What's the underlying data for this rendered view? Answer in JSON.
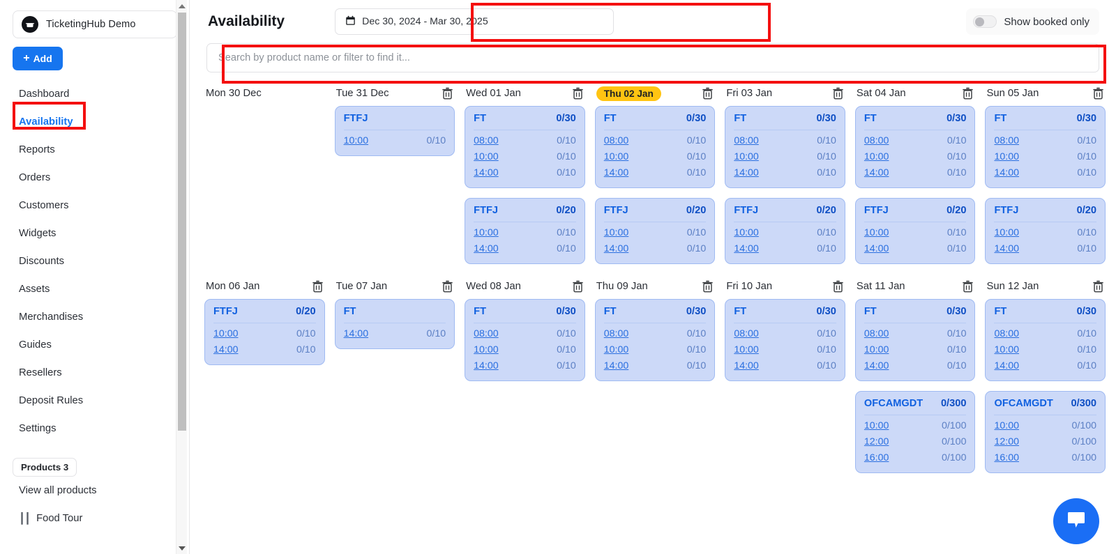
{
  "sidebar": {
    "brand": {
      "name": "TicketingHub Demo",
      "logo_icon": "ticket-circle-icon"
    },
    "add_button": {
      "label": "Add",
      "plus": "+"
    },
    "items": [
      {
        "label": "Dashboard",
        "active": false
      },
      {
        "label": "Availability",
        "active": true
      },
      {
        "label": "Reports",
        "active": false
      },
      {
        "label": "Orders",
        "active": false
      },
      {
        "label": "Customers",
        "active": false
      },
      {
        "label": "Widgets",
        "active": false
      },
      {
        "label": "Discounts",
        "active": false
      },
      {
        "label": "Assets",
        "active": false
      },
      {
        "label": "Merchandises",
        "active": false
      },
      {
        "label": "Guides",
        "active": false
      },
      {
        "label": "Resellers",
        "active": false
      },
      {
        "label": "Deposit Rules",
        "active": false
      },
      {
        "label": "Settings",
        "active": false
      }
    ],
    "products_tag": "Products 3",
    "view_all_products": "View all products",
    "product_items": [
      {
        "label": "Food Tour",
        "handle_icon": "drag-handle-icon"
      }
    ]
  },
  "header": {
    "title": "Availability",
    "date_range": {
      "value": "Dec 30, 2024 - Mar 30, 2025",
      "icon": "calendar-icon"
    },
    "show_booked_only": {
      "label": "Show booked only",
      "enabled": false
    }
  },
  "search": {
    "placeholder": "Search by product name or filter to find it...",
    "value": ""
  },
  "colors": {
    "accent": "#1675ef",
    "card_bg": "#ccd9f8",
    "card_border": "#9fbaf2",
    "today_badge": "#ffc412",
    "annotation": "#f40f0f",
    "chat_fab": "#1a6ef5"
  },
  "calendar": {
    "delete_icon": "trash-icon",
    "weeks": [
      {
        "days": [
          {
            "label": "Mon 30 Dec",
            "today": false,
            "deletable": false,
            "cards": []
          },
          {
            "label": "Tue 31 Dec",
            "today": false,
            "deletable": true,
            "cards": [
              {
                "product": "FTFJ",
                "capacity": "",
                "slots": [
                  {
                    "time": "10:00",
                    "capacity": "0/10"
                  }
                ]
              }
            ]
          },
          {
            "label": "Wed 01 Jan",
            "today": false,
            "deletable": true,
            "cards": [
              {
                "product": "FT",
                "capacity": "0/30",
                "slots": [
                  {
                    "time": "08:00",
                    "capacity": "0/10"
                  },
                  {
                    "time": "10:00",
                    "capacity": "0/10"
                  },
                  {
                    "time": "14:00",
                    "capacity": "0/10"
                  }
                ]
              },
              {
                "product": "FTFJ",
                "capacity": "0/20",
                "slots": [
                  {
                    "time": "10:00",
                    "capacity": "0/10"
                  },
                  {
                    "time": "14:00",
                    "capacity": "0/10"
                  }
                ]
              }
            ]
          },
          {
            "label": "Thu 02 Jan",
            "today": true,
            "deletable": true,
            "cards": [
              {
                "product": "FT",
                "capacity": "0/30",
                "slots": [
                  {
                    "time": "08:00",
                    "capacity": "0/10"
                  },
                  {
                    "time": "10:00",
                    "capacity": "0/10"
                  },
                  {
                    "time": "14:00",
                    "capacity": "0/10"
                  }
                ]
              },
              {
                "product": "FTFJ",
                "capacity": "0/20",
                "slots": [
                  {
                    "time": "10:00",
                    "capacity": "0/10"
                  },
                  {
                    "time": "14:00",
                    "capacity": "0/10"
                  }
                ]
              }
            ]
          },
          {
            "label": "Fri 03 Jan",
            "today": false,
            "deletable": true,
            "cards": [
              {
                "product": "FT",
                "capacity": "0/30",
                "slots": [
                  {
                    "time": "08:00",
                    "capacity": "0/10"
                  },
                  {
                    "time": "10:00",
                    "capacity": "0/10"
                  },
                  {
                    "time": "14:00",
                    "capacity": "0/10"
                  }
                ]
              },
              {
                "product": "FTFJ",
                "capacity": "0/20",
                "slots": [
                  {
                    "time": "10:00",
                    "capacity": "0/10"
                  },
                  {
                    "time": "14:00",
                    "capacity": "0/10"
                  }
                ]
              }
            ]
          },
          {
            "label": "Sat 04 Jan",
            "today": false,
            "deletable": true,
            "cards": [
              {
                "product": "FT",
                "capacity": "0/30",
                "slots": [
                  {
                    "time": "08:00",
                    "capacity": "0/10"
                  },
                  {
                    "time": "10:00",
                    "capacity": "0/10"
                  },
                  {
                    "time": "14:00",
                    "capacity": "0/10"
                  }
                ]
              },
              {
                "product": "FTFJ",
                "capacity": "0/20",
                "slots": [
                  {
                    "time": "10:00",
                    "capacity": "0/10"
                  },
                  {
                    "time": "14:00",
                    "capacity": "0/10"
                  }
                ]
              }
            ]
          },
          {
            "label": "Sun 05 Jan",
            "today": false,
            "deletable": true,
            "cards": [
              {
                "product": "FT",
                "capacity": "0/30",
                "slots": [
                  {
                    "time": "08:00",
                    "capacity": "0/10"
                  },
                  {
                    "time": "10:00",
                    "capacity": "0/10"
                  },
                  {
                    "time": "14:00",
                    "capacity": "0/10"
                  }
                ]
              },
              {
                "product": "FTFJ",
                "capacity": "0/20",
                "slots": [
                  {
                    "time": "10:00",
                    "capacity": "0/10"
                  },
                  {
                    "time": "14:00",
                    "capacity": "0/10"
                  }
                ]
              }
            ]
          }
        ]
      },
      {
        "days": [
          {
            "label": "Mon 06 Jan",
            "today": false,
            "deletable": true,
            "cards": [
              {
                "product": "FTFJ",
                "capacity": "0/20",
                "slots": [
                  {
                    "time": "10:00",
                    "capacity": "0/10"
                  },
                  {
                    "time": "14:00",
                    "capacity": "0/10"
                  }
                ]
              }
            ]
          },
          {
            "label": "Tue 07 Jan",
            "today": false,
            "deletable": true,
            "cards": [
              {
                "product": "FT",
                "capacity": "",
                "slots": [
                  {
                    "time": "14:00",
                    "capacity": "0/10"
                  }
                ]
              }
            ]
          },
          {
            "label": "Wed 08 Jan",
            "today": false,
            "deletable": true,
            "cards": [
              {
                "product": "FT",
                "capacity": "0/30",
                "slots": [
                  {
                    "time": "08:00",
                    "capacity": "0/10"
                  },
                  {
                    "time": "10:00",
                    "capacity": "0/10"
                  },
                  {
                    "time": "14:00",
                    "capacity": "0/10"
                  }
                ]
              }
            ]
          },
          {
            "label": "Thu 09 Jan",
            "today": false,
            "deletable": true,
            "cards": [
              {
                "product": "FT",
                "capacity": "0/30",
                "slots": [
                  {
                    "time": "08:00",
                    "capacity": "0/10"
                  },
                  {
                    "time": "10:00",
                    "capacity": "0/10"
                  },
                  {
                    "time": "14:00",
                    "capacity": "0/10"
                  }
                ]
              }
            ]
          },
          {
            "label": "Fri 10 Jan",
            "today": false,
            "deletable": true,
            "cards": [
              {
                "product": "FT",
                "capacity": "0/30",
                "slots": [
                  {
                    "time": "08:00",
                    "capacity": "0/10"
                  },
                  {
                    "time": "10:00",
                    "capacity": "0/10"
                  },
                  {
                    "time": "14:00",
                    "capacity": "0/10"
                  }
                ]
              }
            ]
          },
          {
            "label": "Sat 11 Jan",
            "today": false,
            "deletable": true,
            "cards": [
              {
                "product": "FT",
                "capacity": "0/30",
                "slots": [
                  {
                    "time": "08:00",
                    "capacity": "0/10"
                  },
                  {
                    "time": "10:00",
                    "capacity": "0/10"
                  },
                  {
                    "time": "14:00",
                    "capacity": "0/10"
                  }
                ]
              },
              {
                "product": "OFCAMGDT",
                "capacity": "0/300",
                "slots": [
                  {
                    "time": "10:00",
                    "capacity": "0/100"
                  },
                  {
                    "time": "12:00",
                    "capacity": "0/100"
                  },
                  {
                    "time": "16:00",
                    "capacity": "0/100"
                  }
                ]
              }
            ]
          },
          {
            "label": "Sun 12 Jan",
            "today": false,
            "deletable": true,
            "cards": [
              {
                "product": "FT",
                "capacity": "0/30",
                "slots": [
                  {
                    "time": "08:00",
                    "capacity": "0/10"
                  },
                  {
                    "time": "10:00",
                    "capacity": "0/10"
                  },
                  {
                    "time": "14:00",
                    "capacity": "0/10"
                  }
                ]
              },
              {
                "product": "OFCAMGDT",
                "capacity": "0/300",
                "slots": [
                  {
                    "time": "10:00",
                    "capacity": "0/100"
                  },
                  {
                    "time": "12:00",
                    "capacity": "0/100"
                  },
                  {
                    "time": "16:00",
                    "capacity": "0/100"
                  }
                ]
              }
            ]
          }
        ]
      }
    ]
  },
  "chat": {
    "icon": "chat-bubble-icon"
  }
}
